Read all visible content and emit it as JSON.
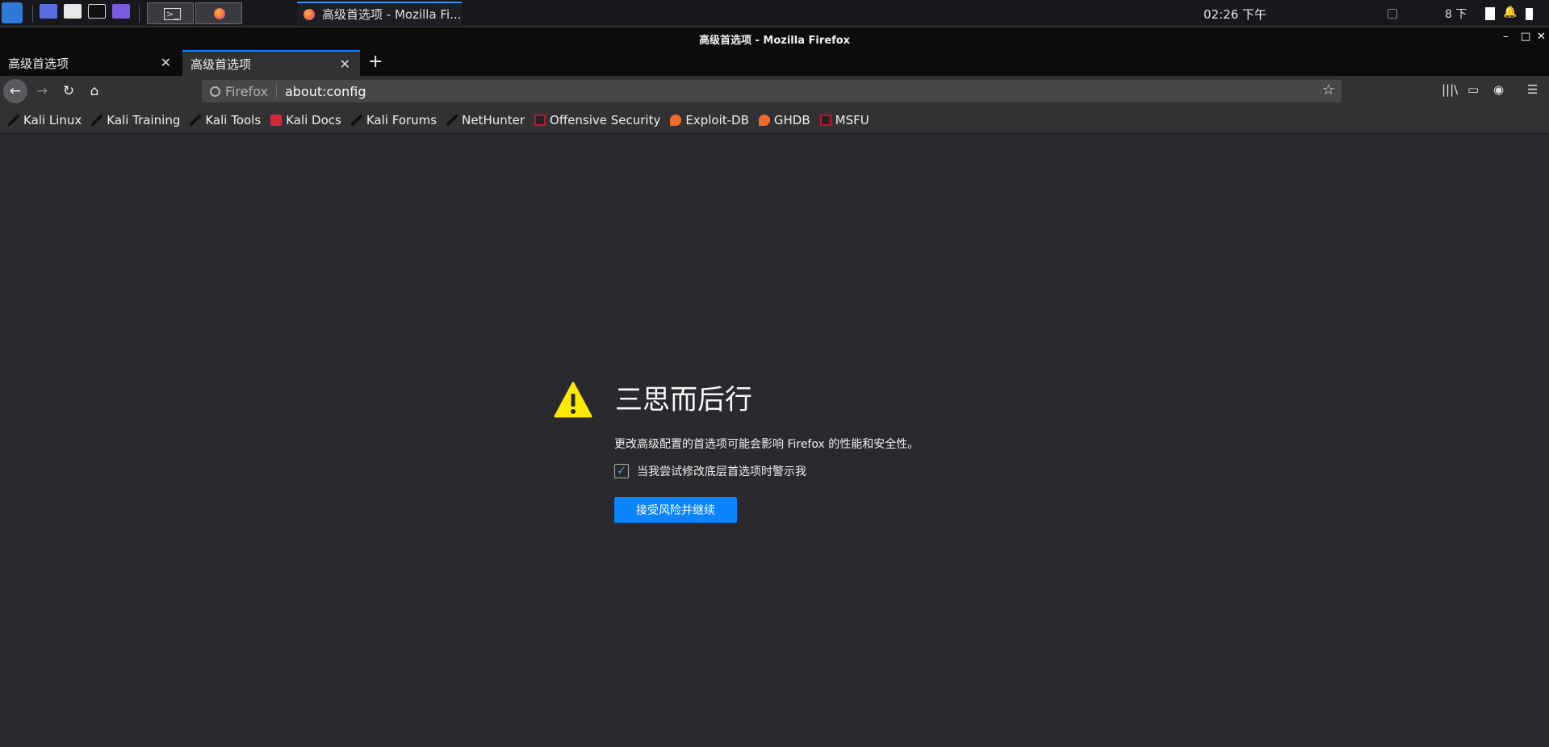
{
  "taskbar": {
    "task_title": "高级首选项 - Mozilla Fi...",
    "clock": "02:26 下午",
    "tray_text": "8 下",
    "icons": [
      "kali-menu-icon",
      "workspace-icon",
      "files-icon",
      "terminal-icon",
      "screen-record-icon"
    ]
  },
  "window": {
    "title": "高级首选项 - Mozilla Firefox",
    "controls": {
      "minimize": "–",
      "maximize": "□",
      "close": "✕"
    }
  },
  "tabs": [
    {
      "label": "高级首选项",
      "active": false
    },
    {
      "label": "高级首选项",
      "active": true
    }
  ],
  "tab_close": "✕",
  "new_tab": "+",
  "nav": {
    "back": "←",
    "forward": "→",
    "reload": "↻",
    "home": "⌂",
    "identity": "Firefox",
    "url": "about:config",
    "bookmark_star": "☆",
    "library": "|||\\",
    "sidebar": "▭",
    "account": "◉",
    "menu": "☰"
  },
  "bookmarks": [
    {
      "label": "Kali Linux",
      "icon": "kali-dragon-icon"
    },
    {
      "label": "Kali Training",
      "icon": "kali-dragon-icon"
    },
    {
      "label": "Kali Tools",
      "icon": "kali-dragon-icon"
    },
    {
      "label": "Kali Docs",
      "icon": "docs-icon"
    },
    {
      "label": "Kali Forums",
      "icon": "kali-dragon-icon"
    },
    {
      "label": "NetHunter",
      "icon": "kali-dragon-icon"
    },
    {
      "label": "Offensive Security",
      "icon": "offsec-icon"
    },
    {
      "label": "Exploit-DB",
      "icon": "exploit-db-icon"
    },
    {
      "label": "GHDB",
      "icon": "exploit-db-icon"
    },
    {
      "label": "MSFU",
      "icon": "offsec-icon"
    }
  ],
  "warning": {
    "title": "三思而后行",
    "description": "更改高级配置的首选项可能会影响 Firefox 的性能和安全性。",
    "checkbox_label": "当我尝试修改底层首选项时警示我",
    "checkbox_checked": true,
    "check_mark": "✓",
    "accept_button": "接受风险并继续",
    "icon_color": "#ffe900"
  },
  "colors": {
    "accent": "#0a84ff",
    "background": "#2a2a2e",
    "toolbar": "#323234"
  }
}
